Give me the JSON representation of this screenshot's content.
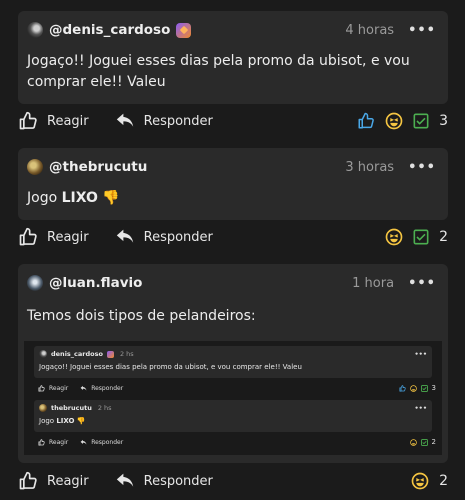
{
  "comments": [
    {
      "handle": "@denis_cardoso",
      "time": "4 horas",
      "text": "Jogaço!! Joguei esses dias pela promo da ubisot, e vou comprar ele!! Valeu",
      "reactions_count": "3"
    },
    {
      "handle": "@thebrucutu",
      "time": "3 horas",
      "text_prefix": "Jogo ",
      "text_bold": "LIXO",
      "emoji": "👎",
      "reactions_count": "2"
    },
    {
      "handle": "@luan.flavio",
      "time": "1 hora",
      "text": "Temos dois tipos de pelandeiros:",
      "reactions_count": "2"
    }
  ],
  "actions": {
    "react_label": "Reagir",
    "reply_label": "Responder",
    "more": "•••"
  },
  "embedded_screenshot": {
    "comments": [
      {
        "handle": "denis_cardoso",
        "time": "2 hs",
        "text": "Jogaço!! Joguei esses dias pela promo da ubisot, e vou comprar ele!! Valeu",
        "count": "3"
      },
      {
        "handle": "thebrucutu",
        "time": "2 hs",
        "text_prefix": "Jogo ",
        "text_bold": "LIXO",
        "emoji": "👎",
        "count": "2"
      }
    ],
    "react_label": "Reagir",
    "reply_label": "Responder",
    "more": "•••"
  },
  "colors": {
    "background": "#1b1b1b",
    "card": "#2a2a2a",
    "like": "#4aa8e8",
    "emoji": "#f5c542",
    "check": "#4caf50"
  }
}
